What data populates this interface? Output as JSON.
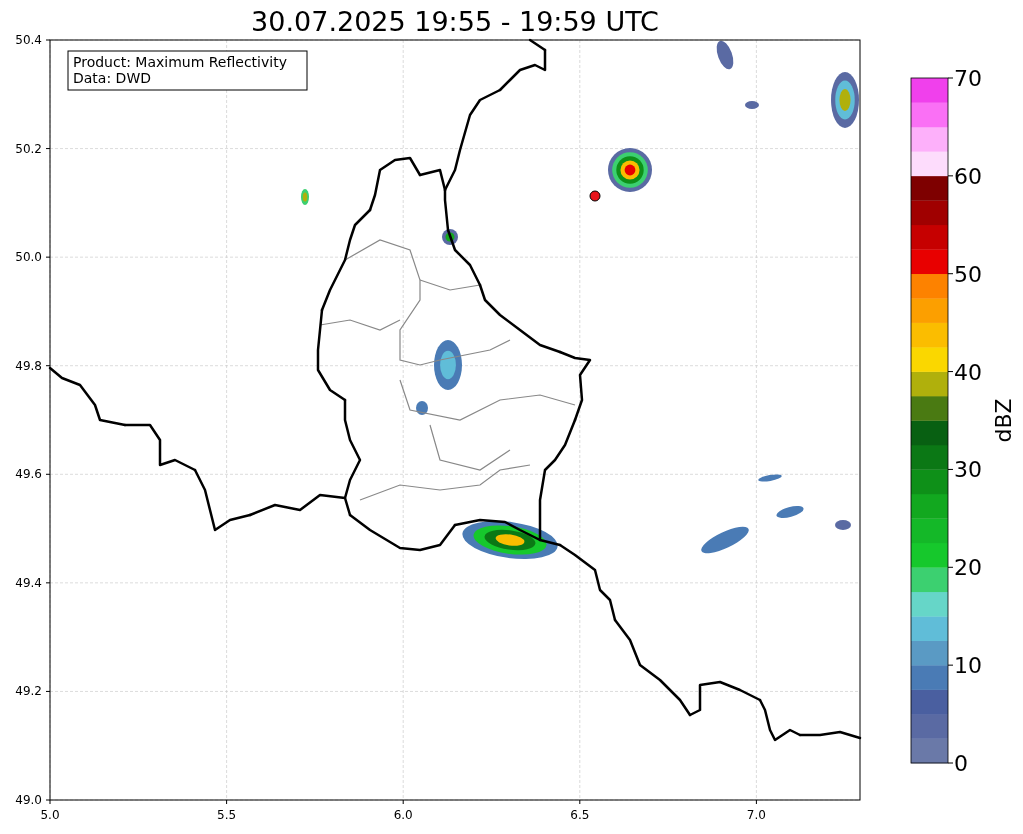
{
  "title": "30.07.2025 19:55 - 19:59 UTC",
  "map": {
    "x_ticks": [
      "5.0",
      "5.5",
      "6.0",
      "6.5",
      "7.0"
    ],
    "y_ticks": [
      "50.4",
      "50.2",
      "50.0",
      "49.8",
      "49.6",
      "49.4",
      "49.2",
      "49.0"
    ],
    "info_box": [
      "Product: Maximum Reflectivity",
      "Data: DWD"
    ]
  },
  "colorbar": {
    "label": "dBZ",
    "ticks": [
      "70",
      "60",
      "50",
      "40",
      "30",
      "20",
      "10",
      "0"
    ],
    "segments": [
      {
        "color": "#6a79a8"
      },
      {
        "color": "#5a6aa3"
      },
      {
        "color": "#4a5fa0"
      },
      {
        "color": "#4a7bb5"
      },
      {
        "color": "#5a9ac4"
      },
      {
        "color": "#60bdd8"
      },
      {
        "color": "#66d6c8"
      },
      {
        "color": "#3cd070"
      },
      {
        "color": "#16c82c"
      },
      {
        "color": "#14b828"
      },
      {
        "color": "#12a81f"
      },
      {
        "color": "#0e9018"
      },
      {
        "color": "#0b7815"
      },
      {
        "color": "#086012"
      },
      {
        "color": "#4a7a12"
      },
      {
        "color": "#b0b00c"
      },
      {
        "color": "#fad700"
      },
      {
        "color": "#fbbd00"
      },
      {
        "color": "#fc9f00"
      },
      {
        "color": "#fd8200"
      },
      {
        "color": "#e80000"
      },
      {
        "color": "#c60000"
      },
      {
        "color": "#a00000"
      },
      {
        "color": "#7e0000"
      },
      {
        "color": "#fddcfc"
      },
      {
        "color": "#fdb0fa"
      },
      {
        "color": "#fa70f5"
      },
      {
        "color": "#f040ec"
      }
    ]
  }
}
